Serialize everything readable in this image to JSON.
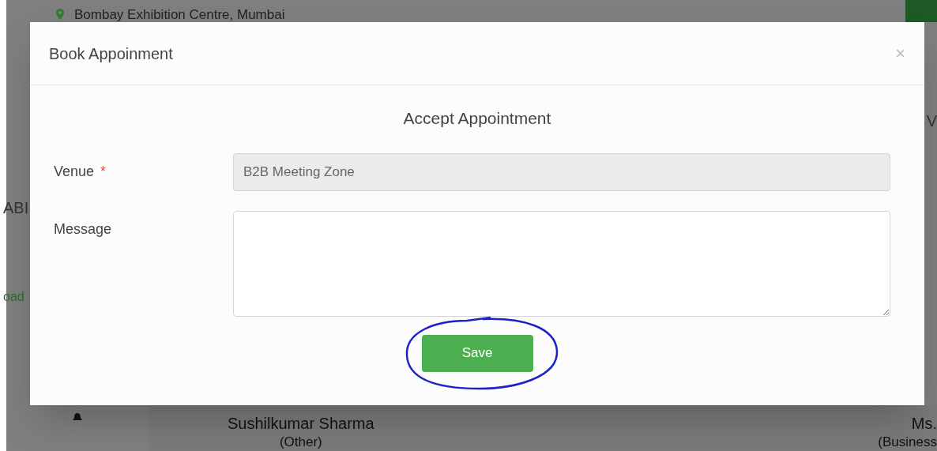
{
  "background": {
    "location": "Bombay Exhibition Centre, Mumbai",
    "side_texts": [
      "ABI",
      "oad"
    ],
    "right_text": "V",
    "people": [
      {
        "name": "Sushilkumar Sharma",
        "role": "(Other)"
      },
      {
        "name": "Ms.",
        "role": "(Business"
      }
    ]
  },
  "dialog": {
    "title": "Book Appoinment",
    "close": "×",
    "heading": "Accept Appointment",
    "fields": [
      {
        "kind": "input",
        "label": "Venue",
        "required_mark": "*",
        "value": "B2B Meeting Zone",
        "disabled": true
      },
      {
        "kind": "textarea",
        "label": "Message",
        "disabled": false
      }
    ],
    "save_button": "Save"
  }
}
